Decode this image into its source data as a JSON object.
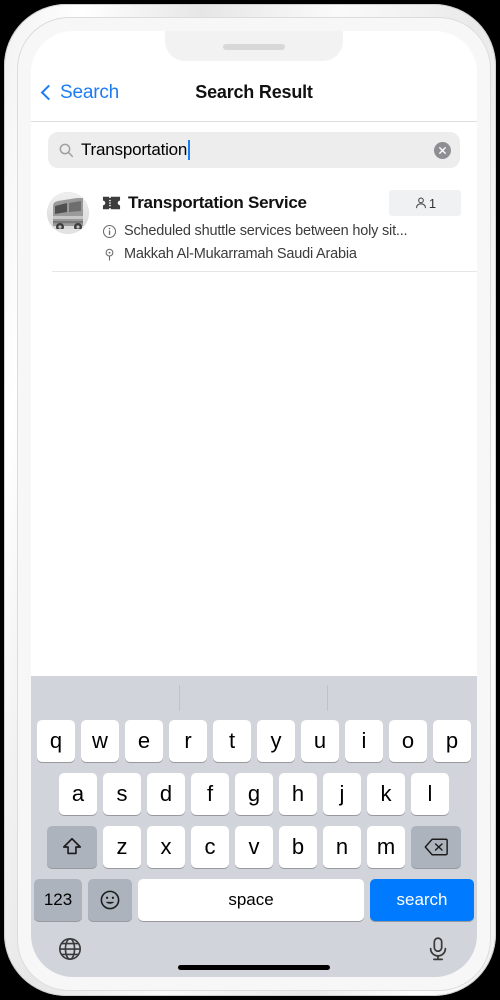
{
  "device": {
    "notch_speaker": "speaker-grille",
    "home_indicator": "home-indicator"
  },
  "navbar": {
    "back_label": "Search",
    "title": "Search Result",
    "back_icon": "chevron-left-icon",
    "accent_color": "#1c7cf2"
  },
  "search": {
    "value": "Transportation",
    "placeholder": "Search",
    "search_icon": "search-icon",
    "clear_icon": "clear-circle-icon",
    "field_bg": "#ededed",
    "caret_color": "#1c7cf2"
  },
  "results": [
    {
      "avatar": "bus-photo-thumbnail",
      "category_icon": "ticket-icon",
      "title": "Transportation Service",
      "badge": {
        "icon": "person-icon",
        "count": "1",
        "bg": "#eff1f3"
      },
      "description_icon": "info-circle-icon",
      "description": "Scheduled shuttle services between holy sit...",
      "location_icon": "map-pin-icon",
      "location": "Makkah Al-Mukarramah Saudi Arabia"
    }
  ],
  "keyboard": {
    "bg": "#d1d5db",
    "row1": [
      "q",
      "w",
      "e",
      "r",
      "t",
      "y",
      "u",
      "i",
      "o",
      "p"
    ],
    "row2": [
      "a",
      "s",
      "d",
      "f",
      "g",
      "h",
      "j",
      "k",
      "l"
    ],
    "row3": [
      "z",
      "x",
      "c",
      "v",
      "b",
      "n",
      "m"
    ],
    "shift_icon": "shift-arrow-icon",
    "delete_icon": "backspace-icon",
    "numbers_label": "123",
    "emoji_icon": "emoji-smiley-icon",
    "space_label": "space",
    "search_label": "search",
    "search_key_color": "#007aff",
    "globe_icon": "globe-icon",
    "mic_icon": "microphone-icon"
  }
}
